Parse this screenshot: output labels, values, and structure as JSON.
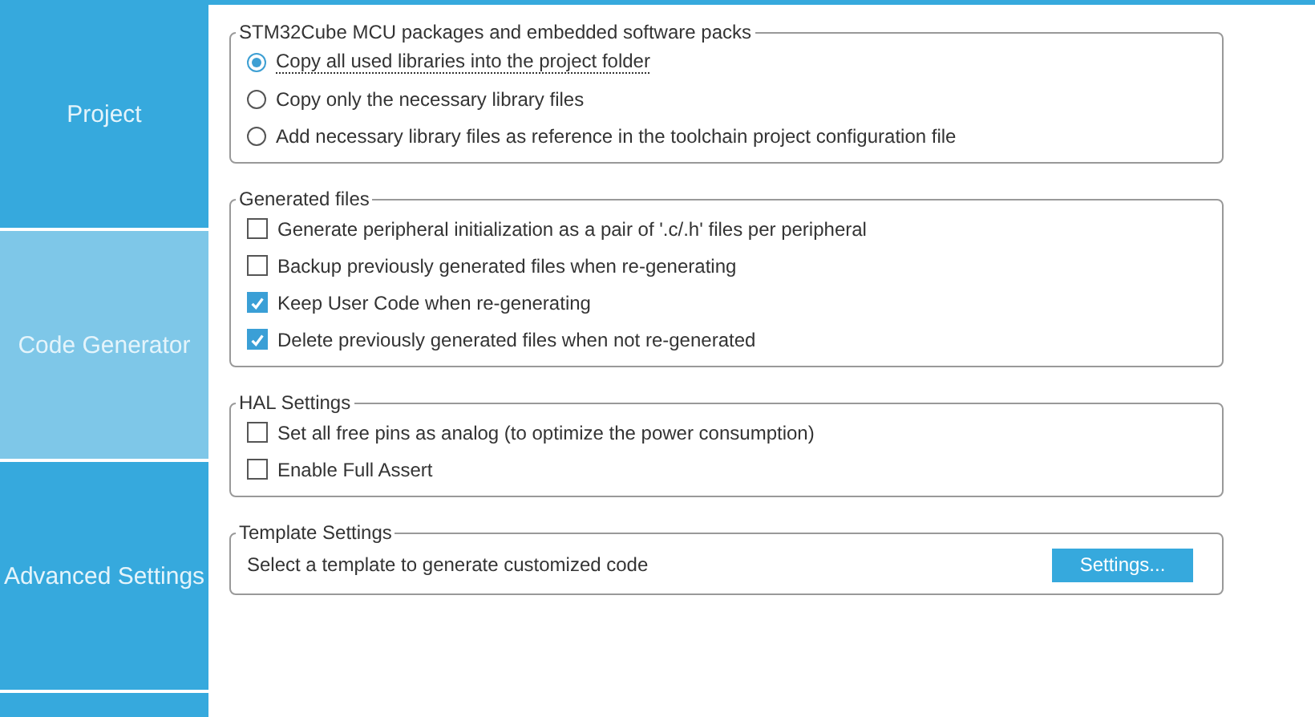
{
  "sidebar": {
    "items": [
      {
        "label": "Project",
        "selected": false
      },
      {
        "label": "Code Generator",
        "selected": true
      },
      {
        "label": "Advanced Settings",
        "selected": false
      }
    ]
  },
  "groups": [
    {
      "title": "STM32Cube MCU packages and embedded software packs",
      "options": [
        {
          "kind": "radio",
          "label": "Copy all used libraries into the project folder",
          "selected": true,
          "focused": true
        },
        {
          "kind": "radio",
          "label": "Copy only the necessary library files",
          "selected": false,
          "focused": false
        },
        {
          "kind": "radio",
          "label": "Add necessary library files as reference in the toolchain project configuration file",
          "selected": false,
          "focused": false
        }
      ]
    },
    {
      "title": "Generated files",
      "options": [
        {
          "kind": "checkbox",
          "label": "Generate peripheral initialization as a pair of '.c/.h' files per peripheral",
          "checked": false
        },
        {
          "kind": "checkbox",
          "label": "Backup previously generated files when re-generating",
          "checked": false
        },
        {
          "kind": "checkbox",
          "label": "Keep User Code when re-generating",
          "checked": true
        },
        {
          "kind": "checkbox",
          "label": "Delete previously generated files when not re-generated",
          "checked": true
        }
      ]
    },
    {
      "title": "HAL Settings",
      "options": [
        {
          "kind": "checkbox",
          "label": "Set all free pins as analog (to optimize the power consumption)",
          "checked": false
        },
        {
          "kind": "checkbox",
          "label": "Enable Full Assert",
          "checked": false
        }
      ]
    },
    {
      "title": "Template Settings",
      "options": [
        {
          "kind": "action",
          "label": "Select a template to generate customized code",
          "button": "Settings..."
        }
      ]
    }
  ]
}
